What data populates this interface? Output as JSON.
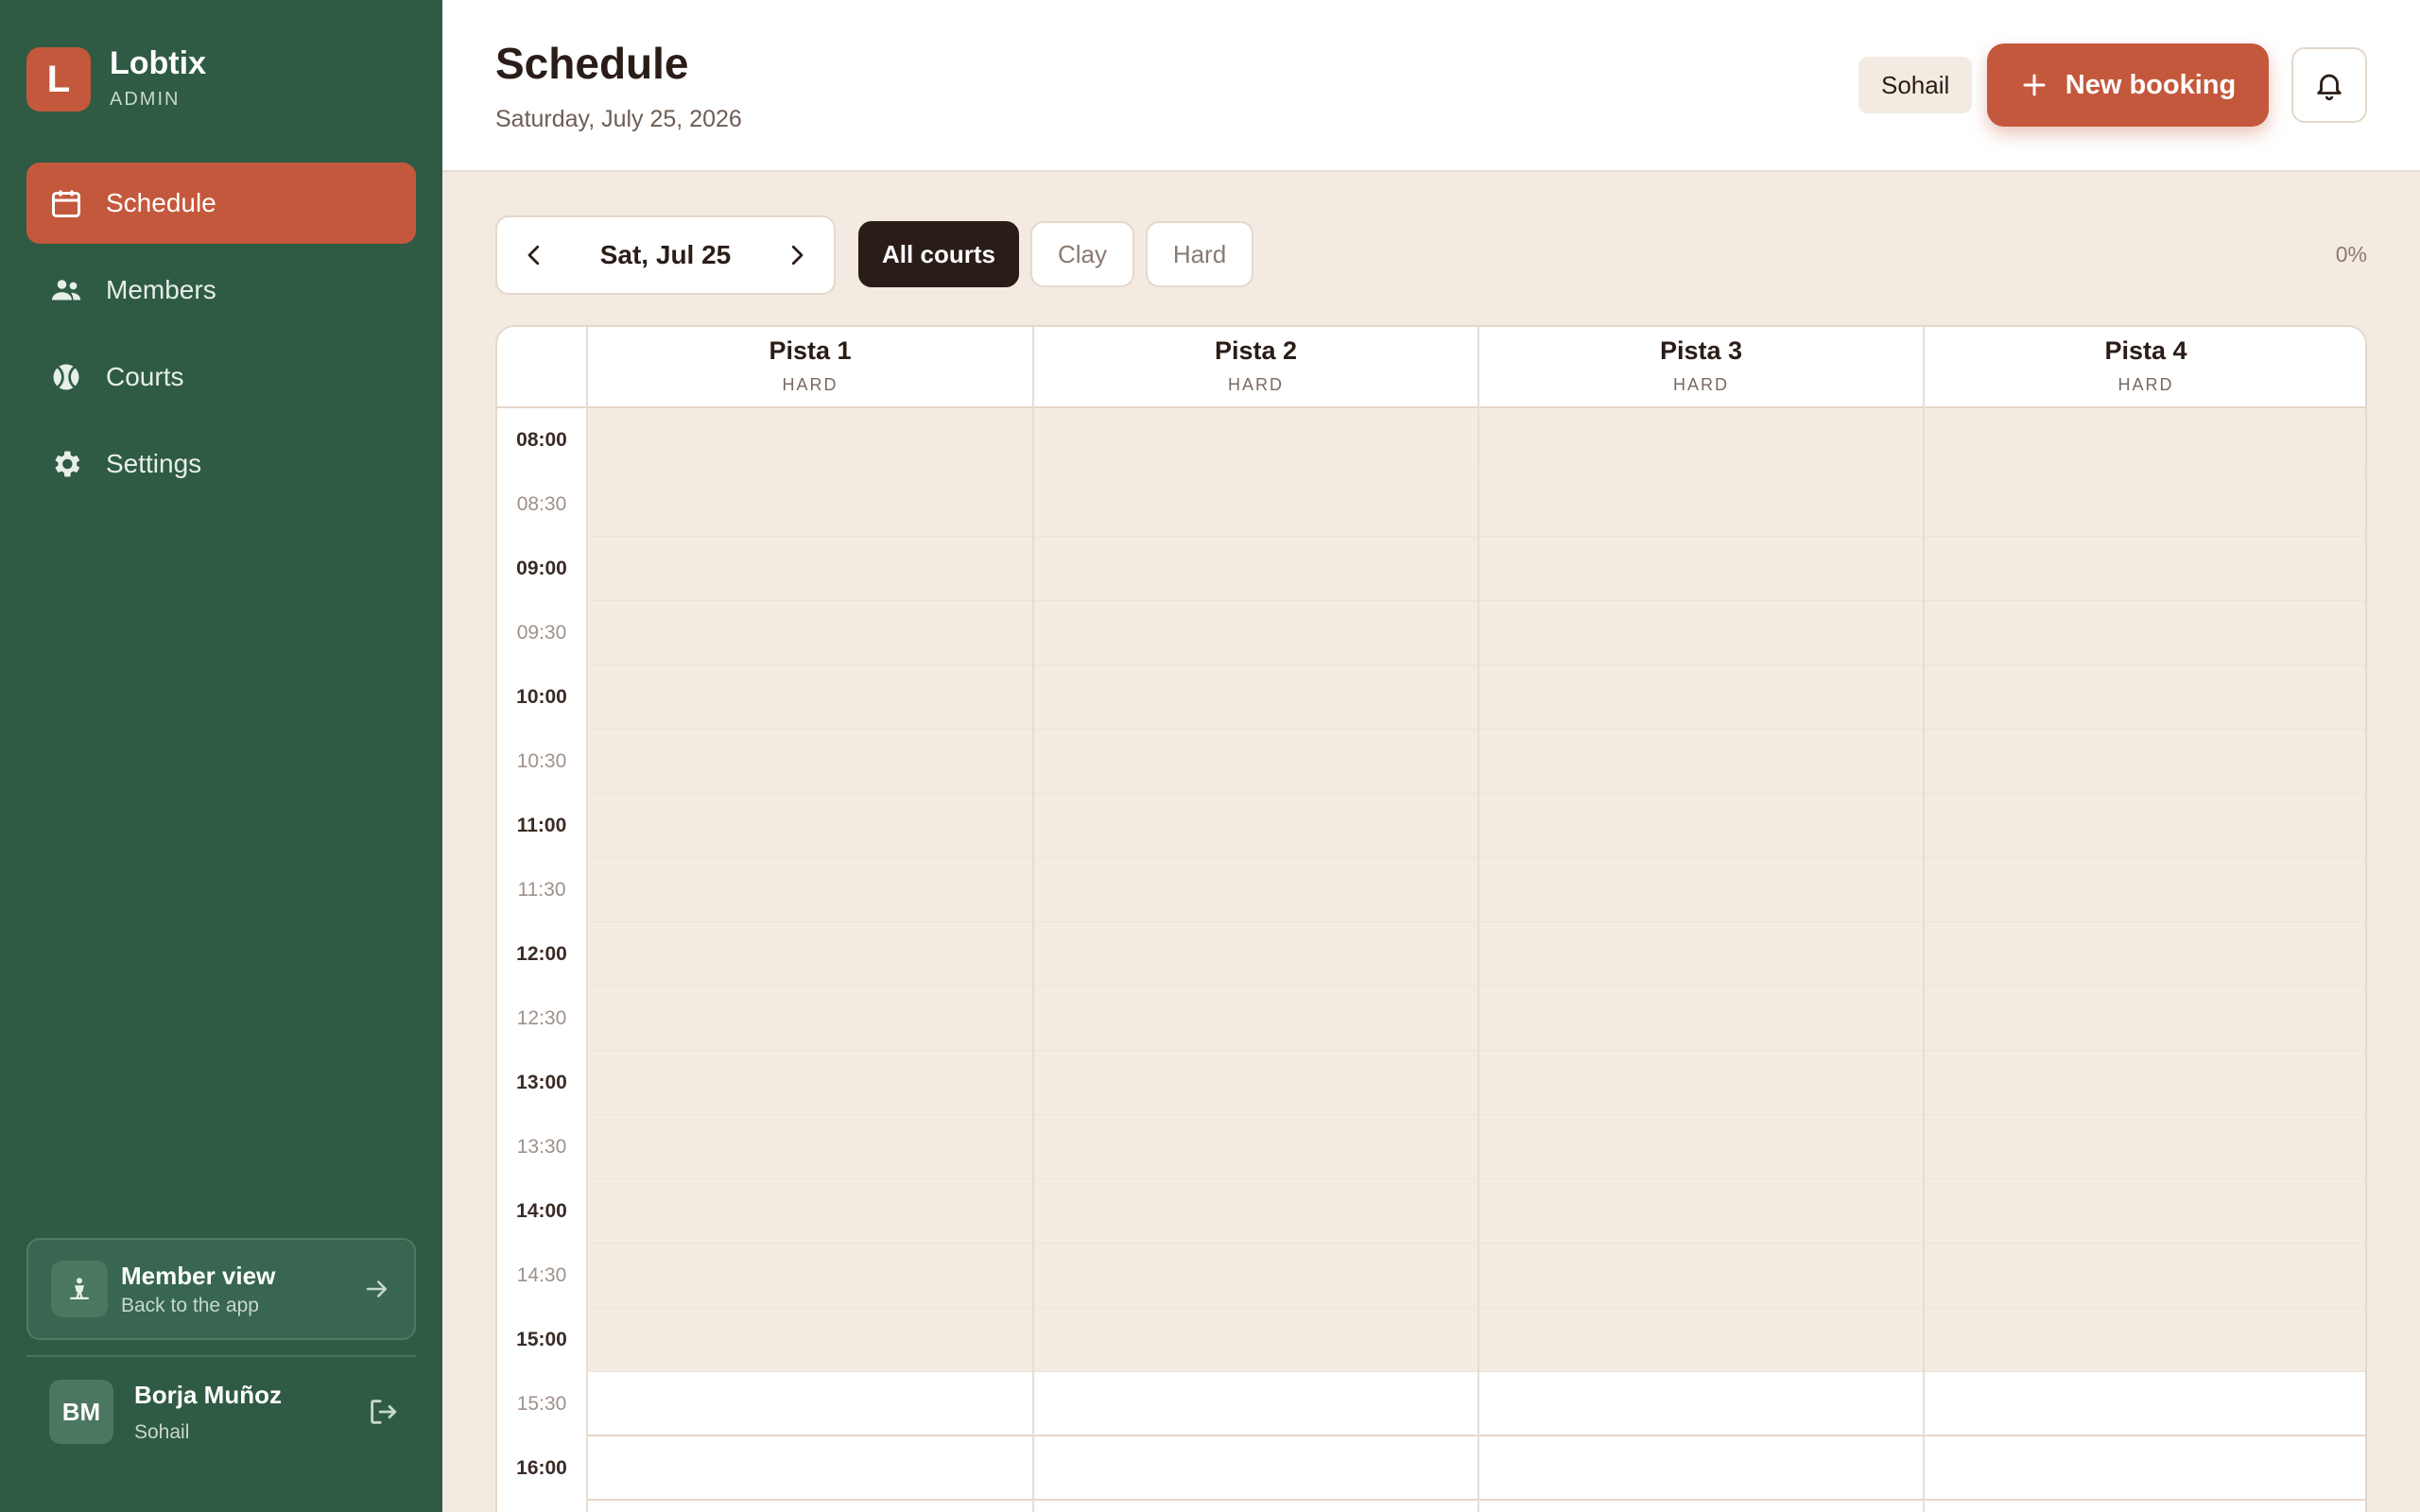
{
  "brand": {
    "logo_letter": "L",
    "name": "Lobtix",
    "role": "ADMIN"
  },
  "nav": [
    {
      "label": "Schedule",
      "icon": "calendar-icon",
      "active": true
    },
    {
      "label": "Members",
      "icon": "people-icon",
      "active": false
    },
    {
      "label": "Courts",
      "icon": "tennis-ball-icon",
      "active": false
    },
    {
      "label": "Settings",
      "icon": "gear-icon",
      "active": false
    }
  ],
  "member_view": {
    "title": "Member view",
    "subtitle": "Back to the app",
    "icon": "person-icon"
  },
  "user": {
    "initials": "BM",
    "name": "Borja Muñoz",
    "club": "Sohail"
  },
  "header": {
    "title": "Schedule",
    "date": "Saturday, July 25, 2026",
    "club_chip": "Sohail",
    "new_booking_label": "New booking"
  },
  "toolbar": {
    "date_label": "Sat, Jul 25",
    "filters": [
      {
        "label": "All courts",
        "active": true
      },
      {
        "label": "Clay",
        "active": false
      },
      {
        "label": "Hard",
        "active": false
      }
    ],
    "occupancy": "0%"
  },
  "courts": [
    {
      "name": "Pista 1",
      "surface": "HARD"
    },
    {
      "name": "Pista 2",
      "surface": "HARD"
    },
    {
      "name": "Pista 3",
      "surface": "HARD"
    },
    {
      "name": "Pista 4",
      "surface": "HARD"
    }
  ],
  "time_slots": [
    "08:00",
    "08:30",
    "09:00",
    "09:30",
    "10:00",
    "10:30",
    "11:00",
    "11:30",
    "12:00",
    "12:30",
    "13:00",
    "13:30",
    "14:00",
    "14:30",
    "15:00",
    "15:30",
    "16:00"
  ],
  "colors": {
    "sidebar": "#2f5a43",
    "accent": "#c4583c",
    "dark_chip": "#2a1d17",
    "background": "#f3ebe2"
  }
}
